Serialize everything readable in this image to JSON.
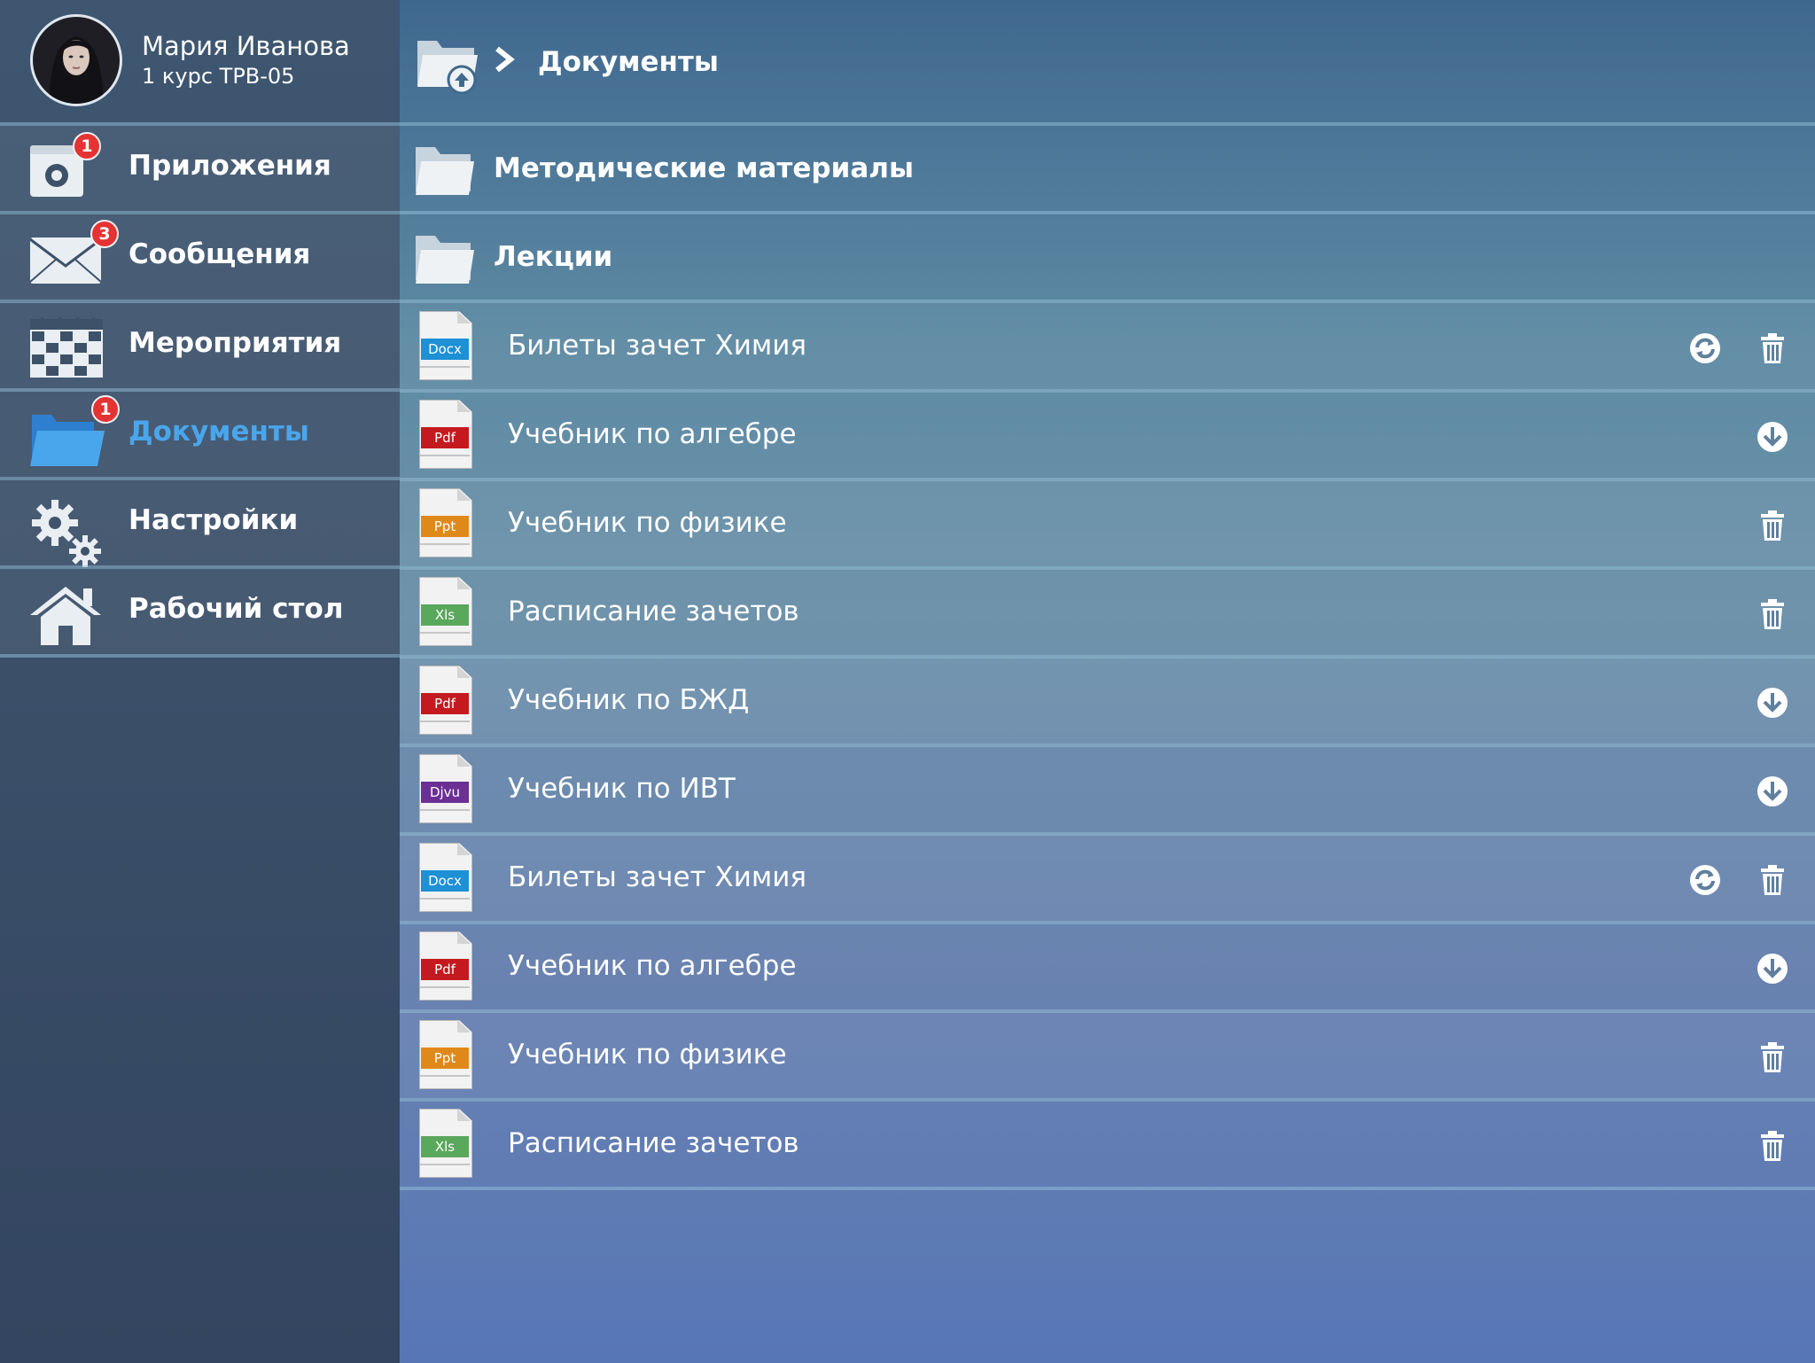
{
  "profile": {
    "name": "Мария Иванова",
    "group": "1 курс ТРВ-05"
  },
  "sidebar": {
    "items": [
      {
        "label": "Приложения",
        "badge": "1"
      },
      {
        "label": "Сообщения",
        "badge": "3"
      },
      {
        "label": "Мероприятия"
      },
      {
        "label": "Документы",
        "badge": "1",
        "active": true
      },
      {
        "label": "Настройки"
      },
      {
        "label": "Рабочий стол"
      }
    ]
  },
  "breadcrumb": {
    "title": "Документы"
  },
  "folders": [
    {
      "label": "Методические материалы"
    },
    {
      "label": "Лекции"
    }
  ],
  "files": [
    {
      "name": "Билеты зачет Химия",
      "type": "Docx",
      "type_color": "#1d90d6",
      "actions": [
        "refresh-icon",
        "trash-icon"
      ]
    },
    {
      "name": "Учебник по алгебре",
      "type": "Pdf",
      "type_color": "#c41a1f",
      "actions": [
        "download-icon"
      ]
    },
    {
      "name": "Учебник по физике",
      "type": "Ppt",
      "type_color": "#e0891b",
      "actions": [
        "trash-icon"
      ]
    },
    {
      "name": "Расписание зачетов",
      "type": "Xls",
      "type_color": "#5aa85c",
      "actions": [
        "trash-icon"
      ]
    },
    {
      "name": "Учебник по БЖД",
      "type": "Pdf",
      "type_color": "#c41a1f",
      "actions": [
        "download-icon"
      ]
    },
    {
      "name": "Учебник по ИВТ",
      "type": "Djvu",
      "type_color": "#6b2f95",
      "actions": [
        "download-icon"
      ]
    },
    {
      "name": "Билеты зачет Химия",
      "type": "Docx",
      "type_color": "#1d90d6",
      "actions": [
        "refresh-icon",
        "trash-icon"
      ]
    },
    {
      "name": "Учебник по алгебре",
      "type": "Pdf",
      "type_color": "#c41a1f",
      "actions": [
        "download-icon"
      ]
    },
    {
      "name": "Учебник по физике",
      "type": "Ppt",
      "type_color": "#e0891b",
      "actions": [
        "trash-icon"
      ]
    },
    {
      "name": "Расписание зачетов",
      "type": "Xls",
      "type_color": "#5aa85c",
      "actions": [
        "trash-icon"
      ]
    }
  ],
  "colors": {
    "active_item": "#4aa6ec",
    "badge": "#e53333"
  }
}
